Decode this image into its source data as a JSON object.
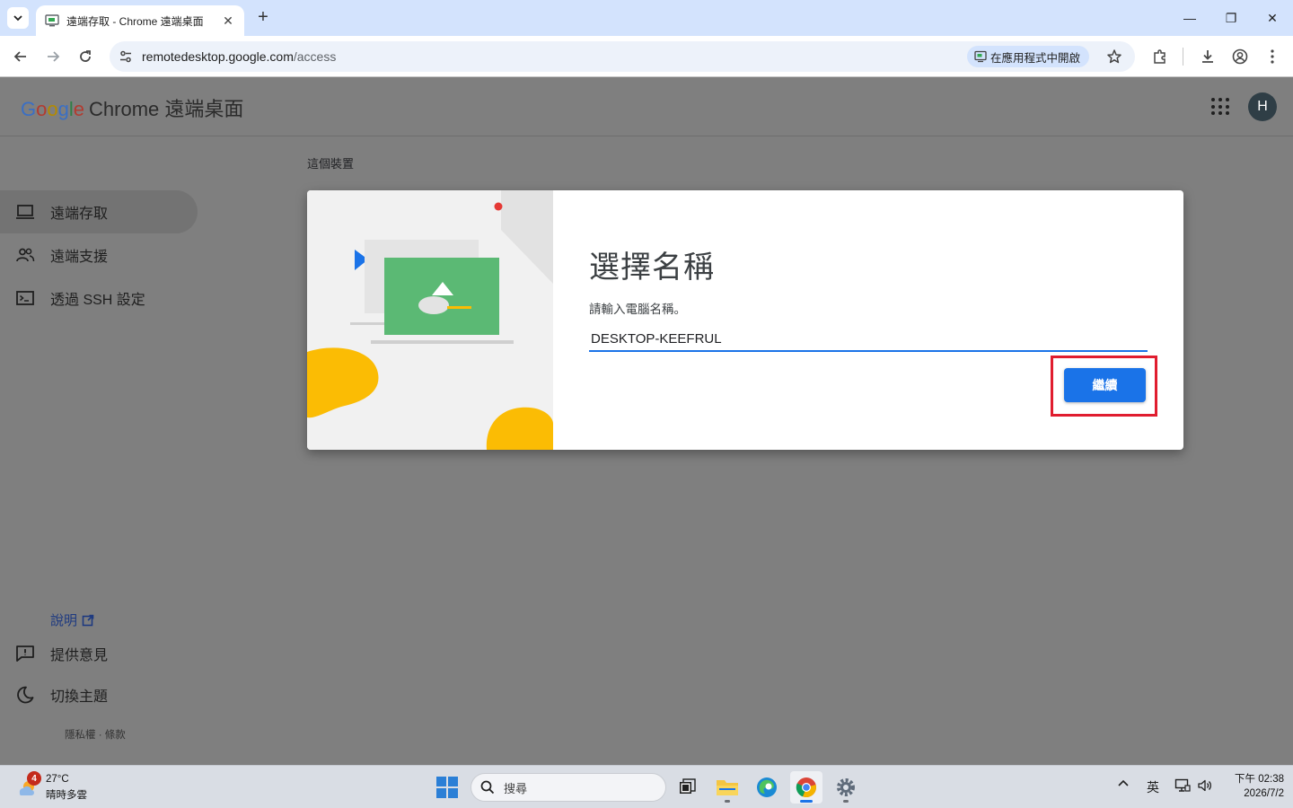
{
  "browser": {
    "tab_title": "遠端存取 - Chrome 遠端桌面",
    "tab_close": "✕",
    "new_tab": "+",
    "url_host": "remotedesktop.google.com",
    "url_path": "/access",
    "open_in_app": "在應用程式中開啟",
    "window_controls": {
      "minimize": "—",
      "maximize": "❐",
      "close": "✕"
    }
  },
  "header": {
    "logo_google": [
      "G",
      "o",
      "o",
      "g",
      "l",
      "e"
    ],
    "product_name": "Chrome 遠端桌面",
    "avatar_letter": "H"
  },
  "sidebar": {
    "items": [
      {
        "label": "遠端存取",
        "icon": "laptop-icon",
        "active": true
      },
      {
        "label": "遠端支援",
        "icon": "people-icon",
        "active": false
      },
      {
        "label": "透過 SSH 設定",
        "icon": "terminal-icon",
        "active": false
      }
    ],
    "help": "說明",
    "feedback": "提供意見",
    "theme": "切換主題",
    "footer": "隱私權 · 條款"
  },
  "main": {
    "section_title": "這個裝置"
  },
  "dialog": {
    "title": "選擇名稱",
    "prompt": "請輸入電腦名稱。",
    "computer_name": "DESKTOP-KEEFRUL",
    "continue_label": "繼續"
  },
  "taskbar": {
    "weather_badge": "4",
    "weather_temp": "27°C",
    "weather_desc": "晴時多雲",
    "search_placeholder": "搜尋",
    "ime": "英",
    "clock_time": "下午 02:38",
    "clock_date": "2026/7/2"
  },
  "colors": {
    "accent": "#1a73e8",
    "highlight": "#e01d2f",
    "overlay": "#7f7f7f"
  }
}
